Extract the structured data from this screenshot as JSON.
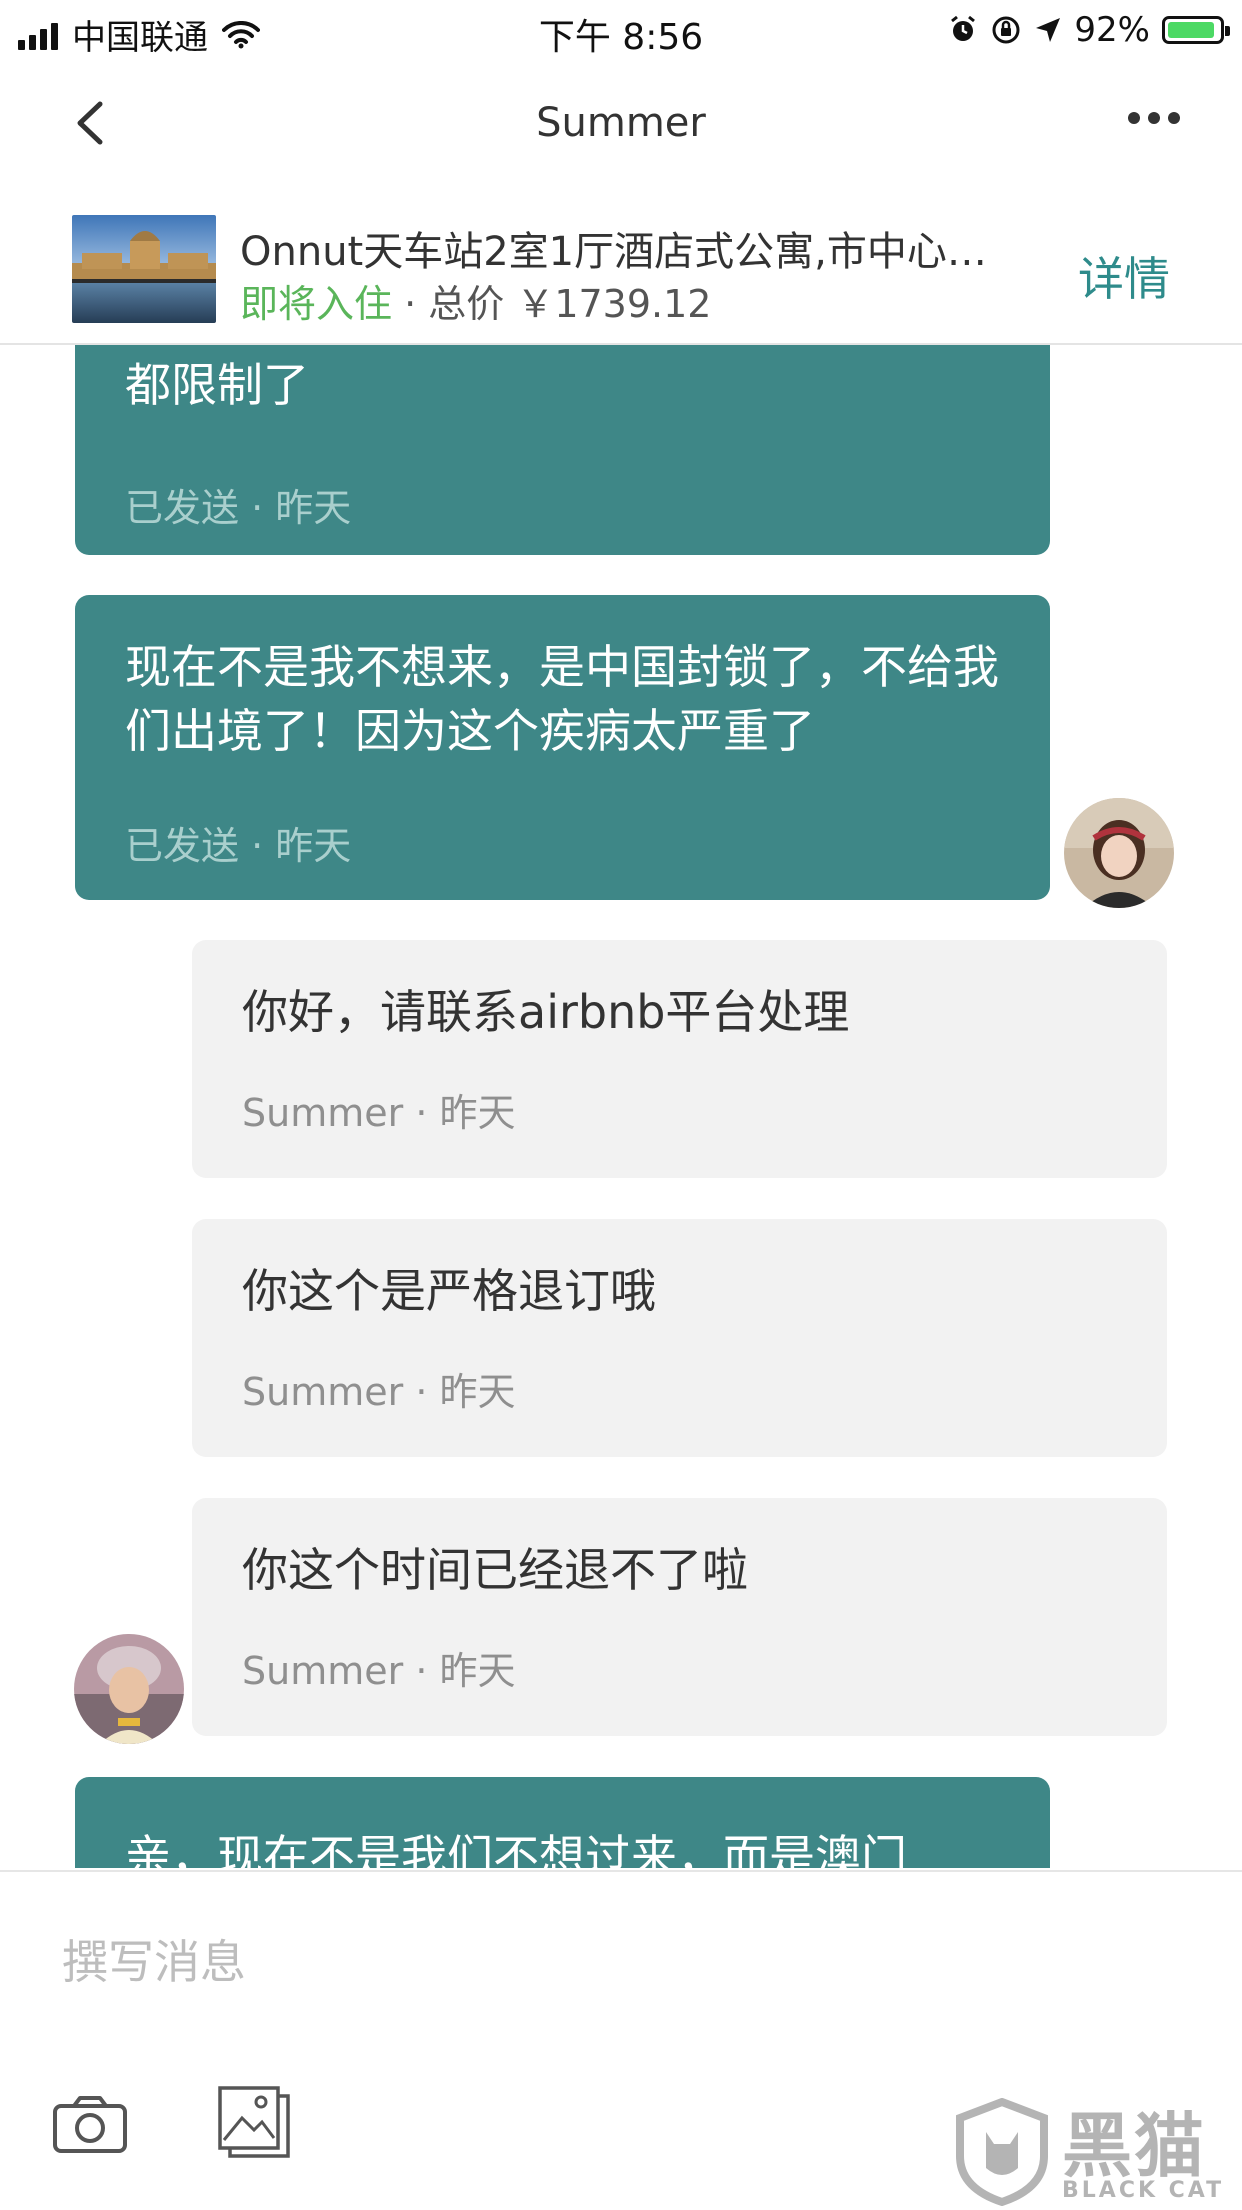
{
  "status_bar": {
    "carrier": "中国联通",
    "time": "下午 8:56",
    "battery": "92%",
    "battery_level": 0.92,
    "icons": [
      "signal-icon",
      "wifi-icon",
      "alarm-icon",
      "rotation-lock-icon",
      "location-icon",
      "battery-icon"
    ]
  },
  "nav": {
    "title": "Summer",
    "back_icon": "chevron-left-icon",
    "more_icon": "more-horizontal-icon"
  },
  "listing": {
    "title": "Onnut天车站2室1厅酒店式公寓,市中心…",
    "status": "即将入住",
    "price_text": " · 总价 ￥1739.12",
    "details_label": "详情",
    "status_color": "#5ab55a",
    "accent_color": "#2e8b8b"
  },
  "messages": [
    {
      "direction": "out",
      "text": "房费可以退换与，我们真的想来，但是出境都限制了",
      "meta": "已发送 · 昨天"
    },
    {
      "direction": "out",
      "text": "现在不是我不想来，是中国封锁了，不给我们出境了！因为这个疾病太严重了",
      "meta": "已发送 · 昨天"
    },
    {
      "direction": "in",
      "text": "你好，请联系airbnb平台处理",
      "meta": "Summer · 昨天"
    },
    {
      "direction": "in",
      "text": "你这个是严格退订哦",
      "meta": "Summer · 昨天"
    },
    {
      "direction": "in",
      "text": "你这个时间已经退不了啦",
      "meta": "Summer · 昨天"
    },
    {
      "direction": "out",
      "text": "亲，现在不是我们不想过来，而是澳门",
      "meta": ""
    }
  ],
  "composer": {
    "placeholder": "撰写消息",
    "camera_icon": "camera-icon",
    "image_icon": "image-icon"
  },
  "watermark": {
    "name": "黑猫",
    "sub": "BLACK CAT"
  },
  "colors": {
    "outgoing_bubble": "#3e8787",
    "incoming_bubble": "#f2f2f2"
  }
}
